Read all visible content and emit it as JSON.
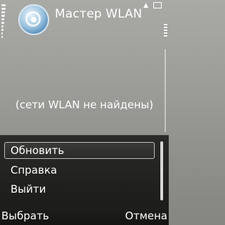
{
  "header": {
    "title": "Мастер WLAN",
    "icon": "wlan-wizard-icon"
  },
  "main": {
    "empty_message": "(сети WLAN не найдены)"
  },
  "options_menu": {
    "items": [
      {
        "label": "Обновить",
        "selected": true
      },
      {
        "label": "Справка",
        "selected": false
      },
      {
        "label": "Выйти",
        "selected": false
      }
    ]
  },
  "softkeys": {
    "left": "Выбрать",
    "right": "Отмена"
  },
  "colors": {
    "background": "#9d9e9a",
    "menu_background": "#222221",
    "text": "#ffffff"
  }
}
